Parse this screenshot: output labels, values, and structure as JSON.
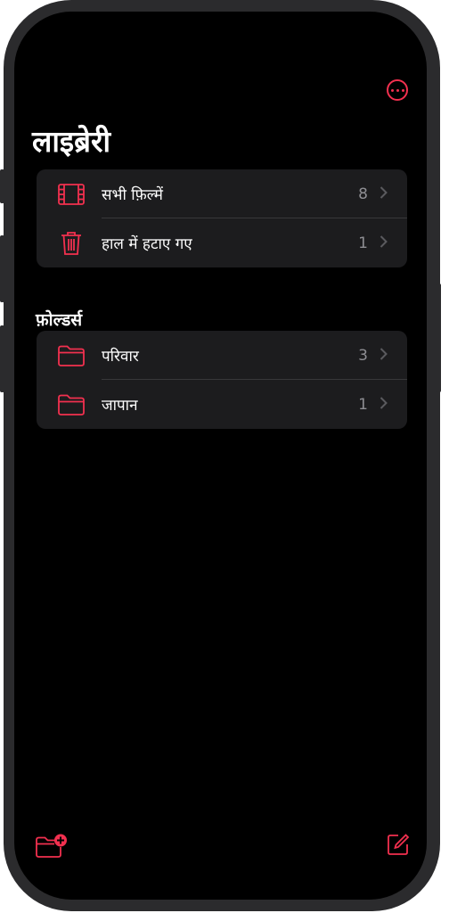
{
  "header": {
    "title": "लाइब्रेरी",
    "more_icon": "ellipsis-circle-icon"
  },
  "library": {
    "items": [
      {
        "label": "सभी फ़िल्में",
        "count": "8",
        "icon": "film-icon"
      },
      {
        "label": "हाल में हटाए गए",
        "count": "1",
        "icon": "trash-icon"
      }
    ]
  },
  "folders": {
    "heading": "फ़ोल्डर्स",
    "items": [
      {
        "label": "परिवार",
        "count": "3",
        "icon": "folder-icon"
      },
      {
        "label": "जापान",
        "count": "1",
        "icon": "folder-icon"
      }
    ]
  },
  "toolbar": {
    "new_folder_icon": "new-folder-icon",
    "compose_icon": "compose-icon"
  },
  "colors": {
    "accent": "#f2304f",
    "background": "#000000",
    "group_bg": "#1c1c1e",
    "secondary_text": "#8e8e93"
  }
}
